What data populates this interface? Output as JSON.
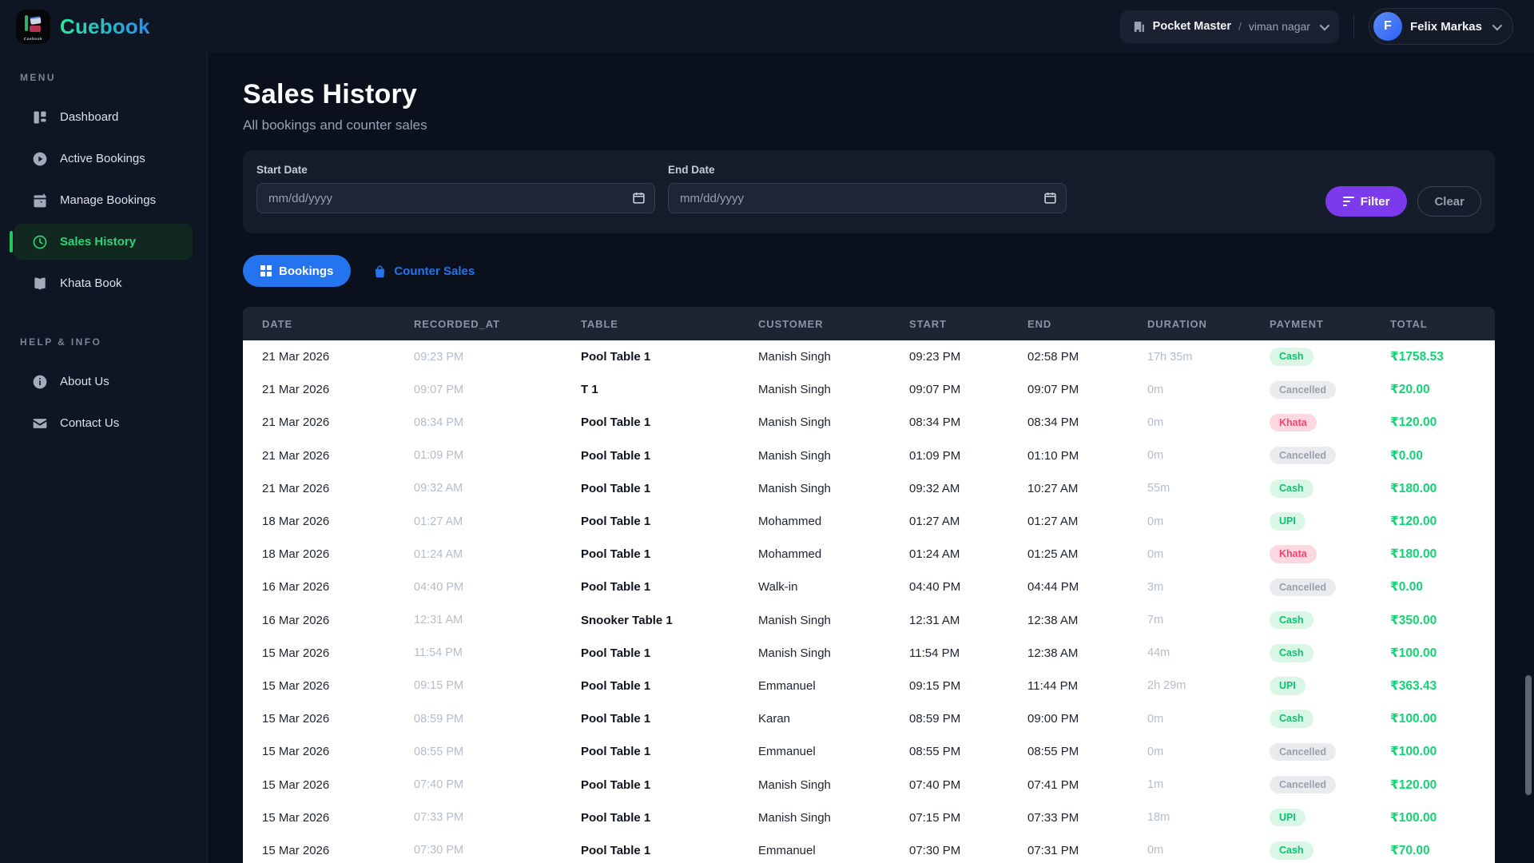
{
  "brand": {
    "name": "Cuebook"
  },
  "topbar": {
    "org": {
      "name": "Pocket Master",
      "separator": "/",
      "branch": "viman nagar"
    },
    "user": {
      "initial": "F",
      "name": "Felix Markas"
    }
  },
  "sidebar": {
    "menu_title": "MENU",
    "menu": [
      {
        "label": "Dashboard",
        "icon": "dashboard-icon",
        "active": false
      },
      {
        "label": "Active Bookings",
        "icon": "play-circle-icon",
        "active": false
      },
      {
        "label": "Manage Bookings",
        "icon": "calendar-icon",
        "active": false
      },
      {
        "label": "Sales History",
        "icon": "clock-icon",
        "active": true
      },
      {
        "label": "Khata Book",
        "icon": "book-icon",
        "active": false
      }
    ],
    "help_title": "HELP & INFO",
    "help": [
      {
        "label": "About Us",
        "icon": "info-icon"
      },
      {
        "label": "Contact Us",
        "icon": "mail-icon"
      }
    ]
  },
  "page": {
    "title": "Sales History",
    "subtitle": "All bookings and counter sales"
  },
  "filters": {
    "start_label": "Start Date",
    "end_label": "End Date",
    "date_placeholder": "mm/dd/yyyy",
    "filter_label": "Filter",
    "clear_label": "Clear"
  },
  "tabs": [
    {
      "label": "Bookings",
      "active": true
    },
    {
      "label": "Counter Sales",
      "active": false
    }
  ],
  "table": {
    "columns": [
      "DATE",
      "RECORDED_AT",
      "TABLE",
      "CUSTOMER",
      "START",
      "END",
      "DURATION",
      "PAYMENT",
      "TOTAL"
    ],
    "rows": [
      {
        "date": "21 Mar 2026",
        "recorded_at": "09:23 PM",
        "table": "Pool Table 1",
        "customer": "Manish Singh",
        "start": "09:23 PM",
        "end": "02:58 PM",
        "duration": "17h 35m",
        "payment": "Cash",
        "total": "₹1758.53"
      },
      {
        "date": "21 Mar 2026",
        "recorded_at": "09:07 PM",
        "table": "T 1",
        "customer": "Manish Singh",
        "start": "09:07 PM",
        "end": "09:07 PM",
        "duration": "0m",
        "payment": "Cancelled",
        "total": "₹20.00"
      },
      {
        "date": "21 Mar 2026",
        "recorded_at": "08:34 PM",
        "table": "Pool Table 1",
        "customer": "Manish Singh",
        "start": "08:34 PM",
        "end": "08:34 PM",
        "duration": "0m",
        "payment": "Khata",
        "total": "₹120.00"
      },
      {
        "date": "21 Mar 2026",
        "recorded_at": "01:09 PM",
        "table": "Pool Table 1",
        "customer": "Manish Singh",
        "start": "01:09 PM",
        "end": "01:10 PM",
        "duration": "0m",
        "payment": "Cancelled",
        "total": "₹0.00"
      },
      {
        "date": "21 Mar 2026",
        "recorded_at": "09:32 AM",
        "table": "Pool Table 1",
        "customer": "Manish Singh",
        "start": "09:32 AM",
        "end": "10:27 AM",
        "duration": "55m",
        "payment": "Cash",
        "total": "₹180.00"
      },
      {
        "date": "18 Mar 2026",
        "recorded_at": "01:27 AM",
        "table": "Pool Table 1",
        "customer": "Mohammed",
        "start": "01:27 AM",
        "end": "01:27 AM",
        "duration": "0m",
        "payment": "UPI",
        "total": "₹120.00"
      },
      {
        "date": "18 Mar 2026",
        "recorded_at": "01:24 AM",
        "table": "Pool Table 1",
        "customer": "Mohammed",
        "start": "01:24 AM",
        "end": "01:25 AM",
        "duration": "0m",
        "payment": "Khata",
        "total": "₹180.00"
      },
      {
        "date": "16 Mar 2026",
        "recorded_at": "04:40 PM",
        "table": "Pool Table 1",
        "customer": "Walk-in",
        "start": "04:40 PM",
        "end": "04:44 PM",
        "duration": "3m",
        "payment": "Cancelled",
        "total": "₹0.00"
      },
      {
        "date": "16 Mar 2026",
        "recorded_at": "12:31 AM",
        "table": "Snooker Table 1",
        "customer": "Manish Singh",
        "start": "12:31 AM",
        "end": "12:38 AM",
        "duration": "7m",
        "payment": "Cash",
        "total": "₹350.00"
      },
      {
        "date": "15 Mar 2026",
        "recorded_at": "11:54 PM",
        "table": "Pool Table 1",
        "customer": "Manish Singh",
        "start": "11:54 PM",
        "end": "12:38 AM",
        "duration": "44m",
        "payment": "Cash",
        "total": "₹100.00"
      },
      {
        "date": "15 Mar 2026",
        "recorded_at": "09:15 PM",
        "table": "Pool Table 1",
        "customer": "Emmanuel",
        "start": "09:15 PM",
        "end": "11:44 PM",
        "duration": "2h 29m",
        "payment": "UPI",
        "total": "₹363.43"
      },
      {
        "date": "15 Mar 2026",
        "recorded_at": "08:59 PM",
        "table": "Pool Table 1",
        "customer": "Karan",
        "start": "08:59 PM",
        "end": "09:00 PM",
        "duration": "0m",
        "payment": "Cash",
        "total": "₹100.00"
      },
      {
        "date": "15 Mar 2026",
        "recorded_at": "08:55 PM",
        "table": "Pool Table 1",
        "customer": "Emmanuel",
        "start": "08:55 PM",
        "end": "08:55 PM",
        "duration": "0m",
        "payment": "Cancelled",
        "total": "₹100.00"
      },
      {
        "date": "15 Mar 2026",
        "recorded_at": "07:40 PM",
        "table": "Pool Table 1",
        "customer": "Manish Singh",
        "start": "07:40 PM",
        "end": "07:41 PM",
        "duration": "1m",
        "payment": "Cancelled",
        "total": "₹120.00"
      },
      {
        "date": "15 Mar 2026",
        "recorded_at": "07:33 PM",
        "table": "Pool Table 1",
        "customer": "Manish Singh",
        "start": "07:15 PM",
        "end": "07:33 PM",
        "duration": "18m",
        "payment": "UPI",
        "total": "₹100.00"
      },
      {
        "date": "15 Mar 2026",
        "recorded_at": "07:30 PM",
        "table": "Pool Table 1",
        "customer": "Emmanuel",
        "start": "07:30 PM",
        "end": "07:31 PM",
        "duration": "0m",
        "payment": "Cash",
        "total": "₹70.00"
      }
    ]
  },
  "colors": {
    "accent_green": "#22c55e",
    "accent_blue": "#2574ef",
    "accent_purple": "#7c3aed",
    "badge_green_text": "#0cc171",
    "badge_pink_text": "#f4426f",
    "total_green": "#14d374",
    "brand_gradient_start": "#2de6a0",
    "brand_gradient_end": "#2b8df0"
  }
}
